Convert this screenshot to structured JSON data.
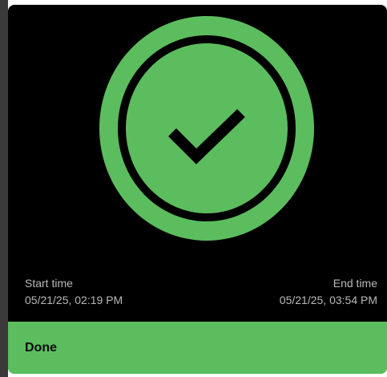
{
  "status": {
    "icon": "check-circle-icon",
    "color": "#5cbd5e"
  },
  "times": {
    "start_label": "Start time",
    "start_value": "05/21/25, 02:19 PM",
    "end_label": "End time",
    "end_value": "05/21/25, 03:54 PM"
  },
  "actions": {
    "done_label": "Done"
  },
  "colors": {
    "background": "#000000",
    "accent": "#5cbd5e",
    "muted_text": "#b9b9b9"
  }
}
